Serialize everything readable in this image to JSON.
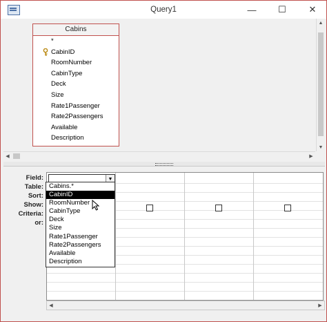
{
  "window": {
    "title": "Query1"
  },
  "titlebar_controls": {
    "minimize": "—",
    "maximize": "☐",
    "close": "✕"
  },
  "field_list": {
    "table_name": "Cabins",
    "fields": [
      "*",
      "CabinID",
      "RoomNumber",
      "CabinType",
      "Deck",
      "Size",
      "Rate1Passenger",
      "Rate2Passengers",
      "Available",
      "Description"
    ],
    "primary_key": "CabinID"
  },
  "design_grid": {
    "row_labels": [
      "Field:",
      "Table:",
      "Sort:",
      "Show:",
      "Criteria:",
      "or:"
    ],
    "field_value": ""
  },
  "field_dropdown": {
    "options": [
      "Cabins.*",
      "CabinID",
      "RoomNumber",
      "CabinType",
      "Deck",
      "Size",
      "Rate1Passenger",
      "Rate2Passengers",
      "Available",
      "Description"
    ],
    "highlighted": "CabinID"
  },
  "icons": {
    "scroll_up": "▲",
    "scroll_down": "▼",
    "scroll_left": "◀",
    "scroll_right": "▶",
    "dropdown": "▼"
  }
}
